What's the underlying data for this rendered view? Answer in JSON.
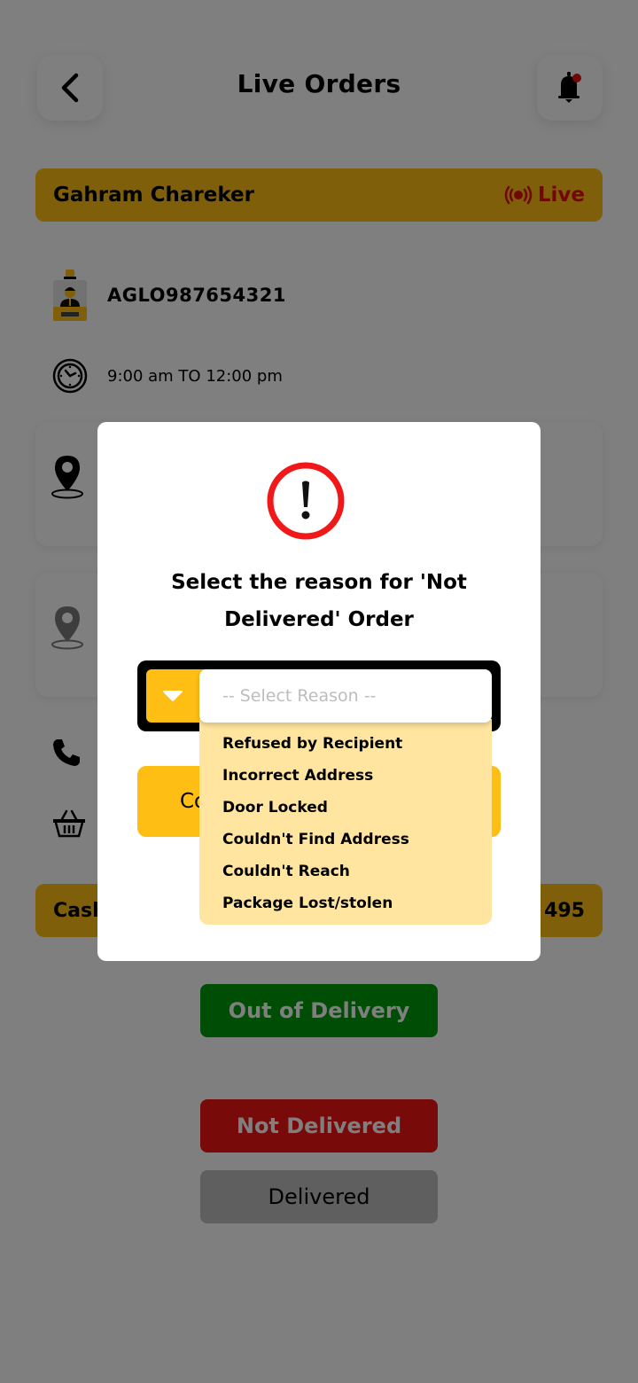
{
  "header": {
    "title": "Live Orders",
    "back_icon": "chevron-left-icon",
    "bell_icon": "bell-icon",
    "notification_dot": true
  },
  "customer": {
    "name": "Gahram Chareker",
    "live_label": "Live",
    "live_icon": "live-broadcast-icon"
  },
  "order": {
    "agent_id": "AGLO987654321",
    "time_window": "9:00 am TO 12:00 pm"
  },
  "cash": {
    "label": "Cash",
    "amount_visible": "495"
  },
  "status_buttons": {
    "out_for_delivery": "Out of Delivery",
    "not_delivered": "Not Delivered",
    "delivered": "Delivered"
  },
  "modal": {
    "icon": "alert-circle-icon",
    "title": "Select the reason for 'Not Delivered' Order",
    "select_placeholder": "-- Select Reason --",
    "confirm_label_visible": "Co",
    "reasons": [
      "Refused by Recipient",
      "Incorrect Address",
      "Door Locked",
      "Couldn't Find Address",
      "Couldn't Reach",
      "Package Lost/stolen"
    ]
  },
  "colors": {
    "accent_yellow": "#FFBE13",
    "live_red": "#E01010",
    "green": "#009B0B",
    "red": "#F01515",
    "gray": "#BEBEBE",
    "dropdown_bg": "#FFE59F",
    "alert_ring": "#F01818"
  }
}
